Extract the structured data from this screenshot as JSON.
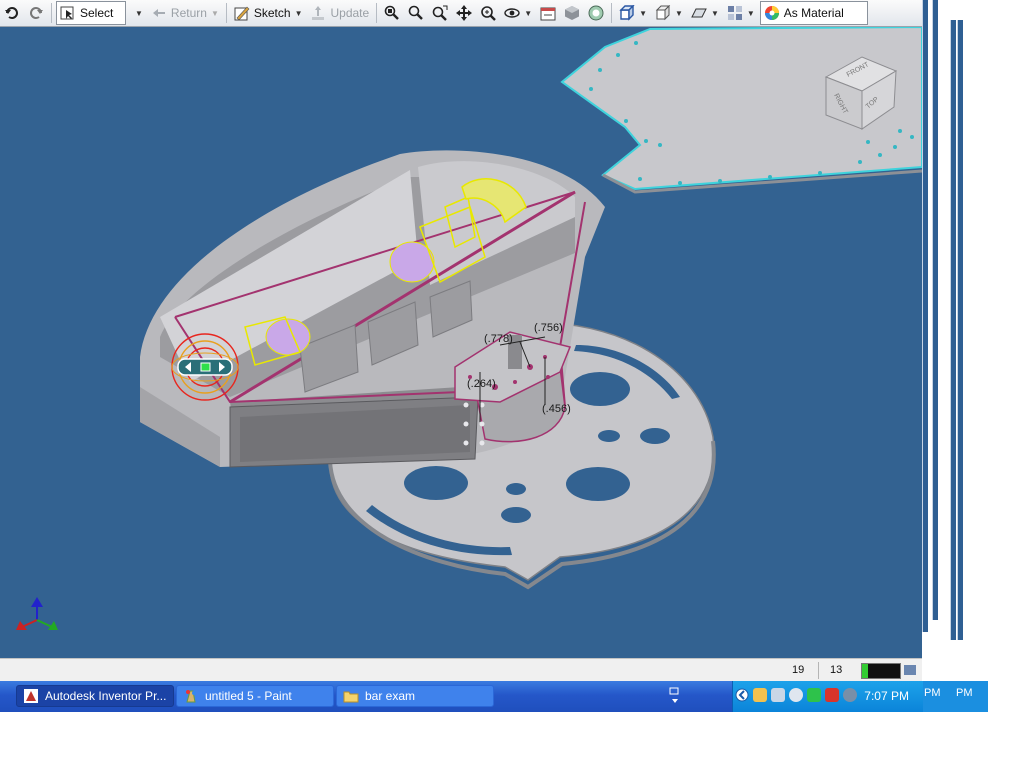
{
  "toolbar": {
    "select_label": "Select",
    "return_label": "Return",
    "sketch_label": "Sketch",
    "update_label": "Update",
    "material_label": "As Material"
  },
  "viewcube": {
    "front": "FRONT",
    "right": "RIGHT",
    "top": "TOP"
  },
  "dimensions": {
    "d1": "(.778)",
    "d2": "(.756)",
    "d3": "(.264)",
    "d4": "(.456)"
  },
  "statusbar": {
    "val1": "19",
    "val2": "13"
  },
  "taskbar": {
    "items": [
      {
        "label": "Autodesk Inventor Pr..."
      },
      {
        "label": "untitled 5 - Paint"
      },
      {
        "label": "bar exam"
      }
    ],
    "clock": "7:07 PM",
    "side_pm": "PM"
  },
  "colors": {
    "viewport_bg": "#336291",
    "taskbar_blue": "#2557c9",
    "highlight_magenta": "#a3336f",
    "selection_yellow": "#e8e800"
  }
}
